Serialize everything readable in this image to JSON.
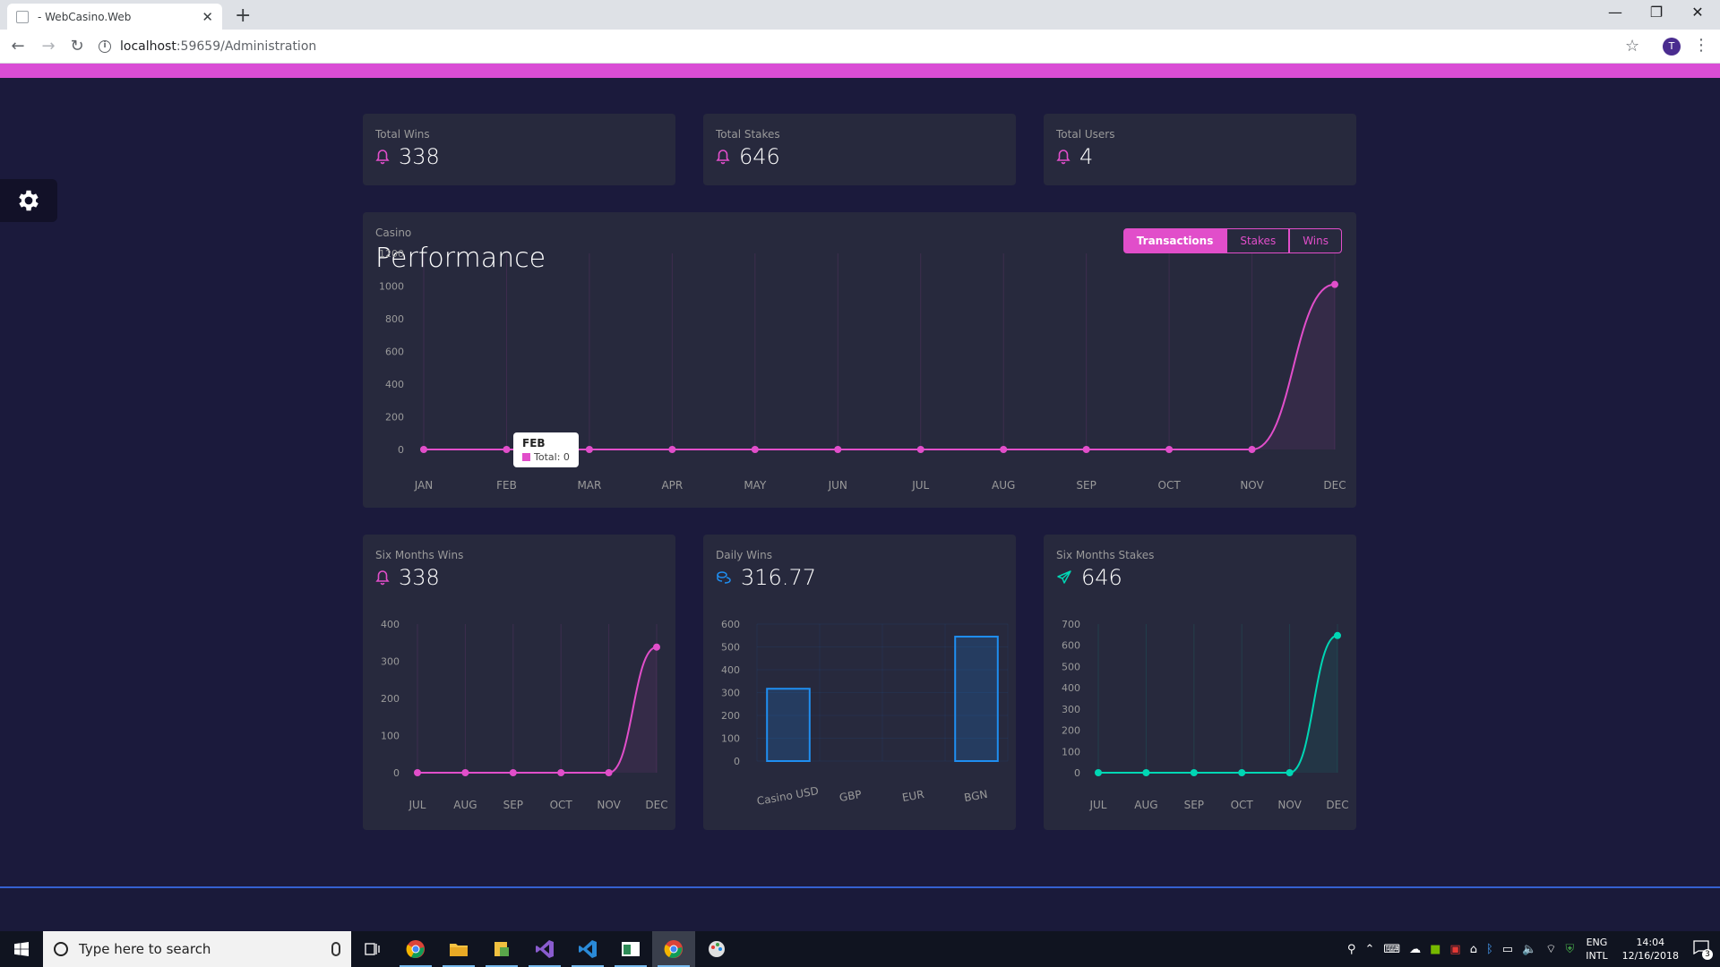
{
  "browser": {
    "tab_title": "- WebCasino.Web",
    "url_host": "localhost",
    "url_rest": ":59659/Administration",
    "profile_initial": "T"
  },
  "stats": [
    {
      "label": "Total Wins",
      "value": "338",
      "icon": "bell-icon"
    },
    {
      "label": "Total Stakes",
      "value": "646",
      "icon": "bell-icon"
    },
    {
      "label": "Total Users",
      "value": "4",
      "icon": "bell-icon"
    }
  ],
  "performance": {
    "subtitle": "Casino",
    "title": "Performance",
    "buttons": [
      "Transactions",
      "Stakes",
      "Wins"
    ],
    "active_button": "Transactions",
    "tooltip": {
      "title": "FEB",
      "label": "Total: 0"
    }
  },
  "bottom_cards": [
    {
      "label": "Six Months Wins",
      "value": "338",
      "icon": "bell-icon"
    },
    {
      "label": "Daily Wins",
      "value": "316.77",
      "icon": "coins-icon"
    },
    {
      "label": "Six Months Stakes",
      "value": "646",
      "icon": "send-icon"
    }
  ],
  "colors": {
    "pink": "#e14eca",
    "teal": "#00d6b4",
    "blue": "#1f8ef1",
    "card": "#27293d",
    "bg": "#1b1a3c"
  },
  "chart_data": [
    {
      "type": "line",
      "id": "performance",
      "categories": [
        "JAN",
        "FEB",
        "MAR",
        "APR",
        "MAY",
        "JUN",
        "JUL",
        "AUG",
        "SEP",
        "OCT",
        "NOV",
        "DEC"
      ],
      "values": [
        0,
        0,
        0,
        0,
        0,
        0,
        0,
        0,
        0,
        0,
        0,
        1010
      ],
      "yticks": [
        0,
        200,
        400,
        600,
        800,
        1000,
        1200
      ],
      "ylim": [
        0,
        1200
      ],
      "color": "#e14eca"
    },
    {
      "type": "line",
      "id": "six-months-wins",
      "categories": [
        "JUL",
        "AUG",
        "SEP",
        "OCT",
        "NOV",
        "DEC"
      ],
      "values": [
        0,
        0,
        0,
        0,
        0,
        338
      ],
      "yticks": [
        0,
        100,
        200,
        300,
        400
      ],
      "ylim": [
        0,
        400
      ],
      "color": "#e14eca"
    },
    {
      "type": "bar",
      "id": "daily-wins",
      "categories": [
        "Casino USD",
        "GBP",
        "EUR",
        "BGN"
      ],
      "values": [
        316.77,
        0,
        0,
        545
      ],
      "yticks": [
        0,
        100,
        200,
        300,
        400,
        500,
        600
      ],
      "ylim": [
        0,
        600
      ],
      "color": "#1f8ef1"
    },
    {
      "type": "line",
      "id": "six-months-stakes",
      "categories": [
        "JUL",
        "AUG",
        "SEP",
        "OCT",
        "NOV",
        "DEC"
      ],
      "values": [
        0,
        0,
        0,
        0,
        0,
        646
      ],
      "yticks": [
        0,
        100,
        200,
        300,
        400,
        500,
        600,
        700
      ],
      "ylim": [
        0,
        700
      ],
      "color": "#00d6b4"
    }
  ],
  "taskbar": {
    "search_placeholder": "Type here to search",
    "lang_top": "ENG",
    "lang_bottom": "INTL",
    "time": "14:04",
    "date": "12/16/2018",
    "notif_count": "3"
  }
}
